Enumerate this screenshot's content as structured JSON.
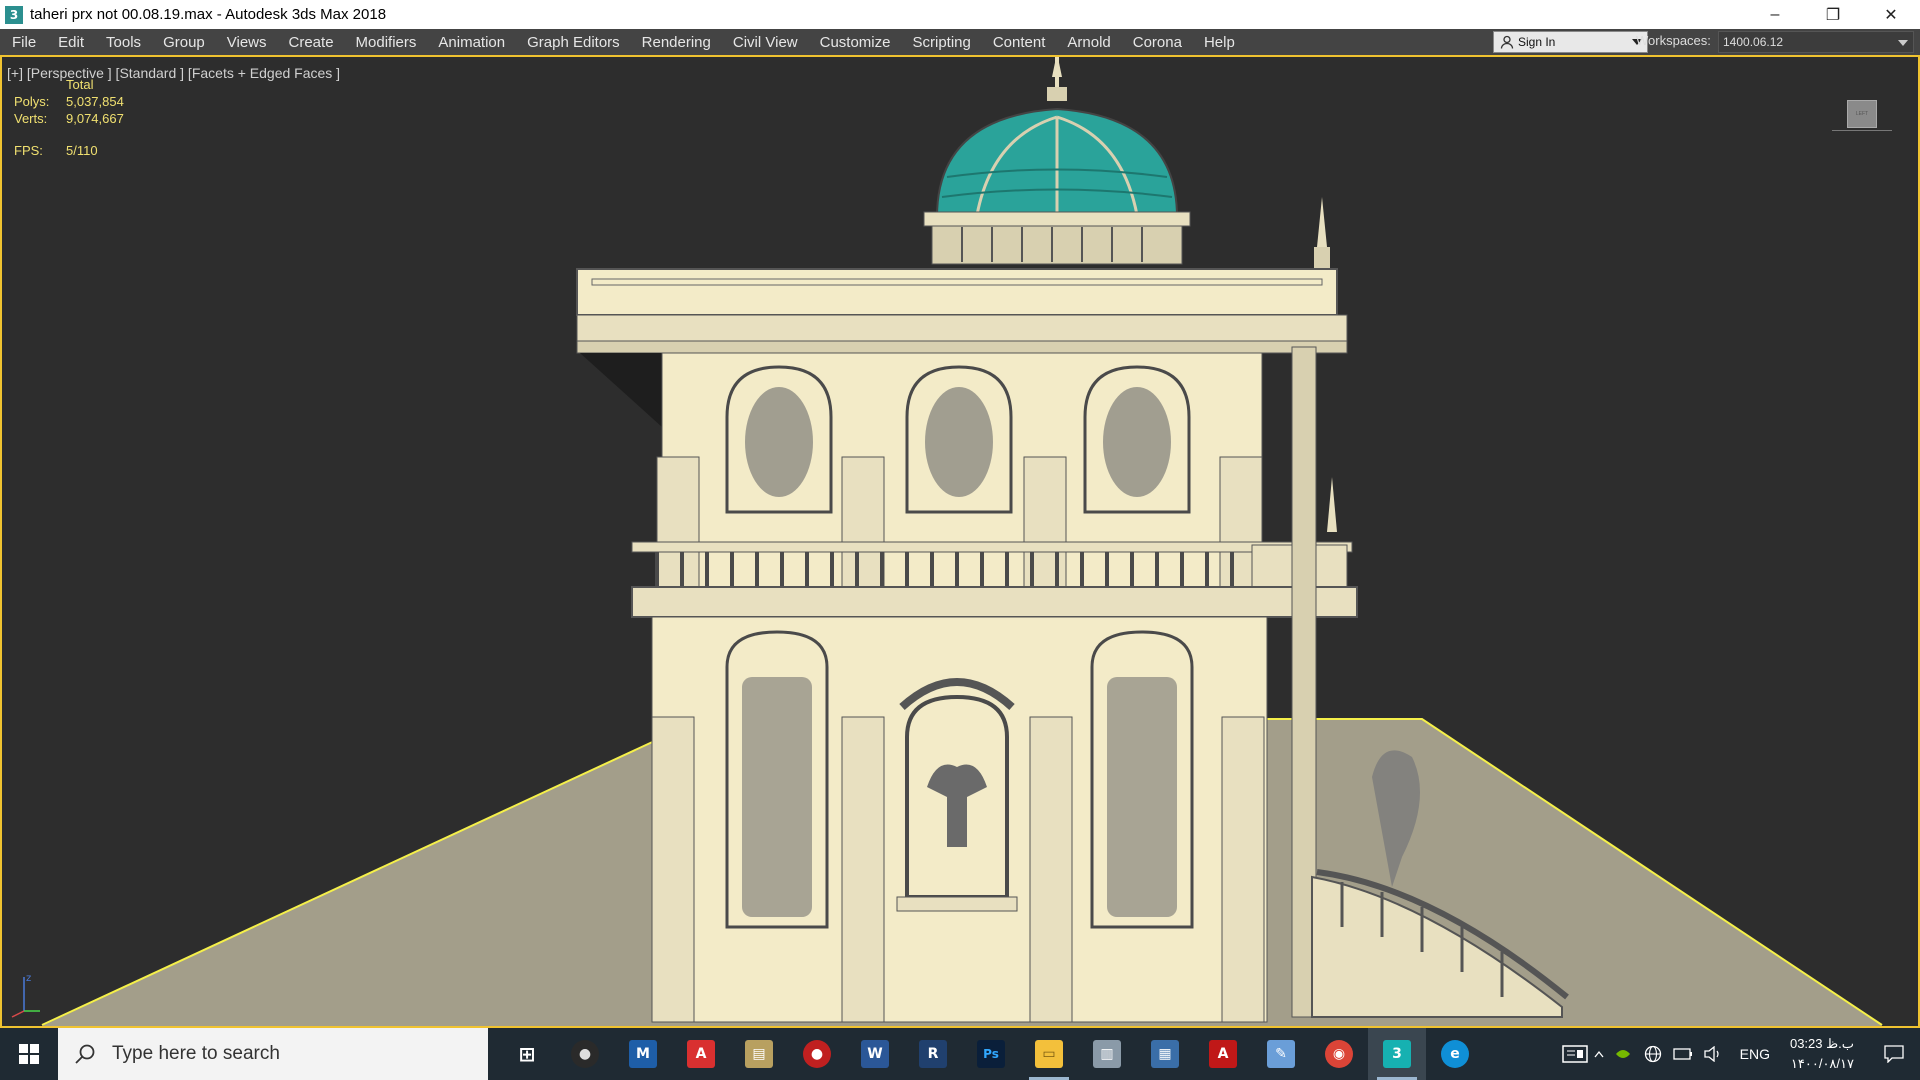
{
  "window": {
    "title": "taheri prx not 00.08.19.max - Autodesk 3ds Max 2018",
    "icon_label": "3",
    "minimize": "–",
    "restore": "❐",
    "close": "✕"
  },
  "menu": {
    "items": [
      "File",
      "Edit",
      "Tools",
      "Group",
      "Views",
      "Create",
      "Modifiers",
      "Animation",
      "Graph Editors",
      "Rendering",
      "Civil View",
      "Customize",
      "Scripting",
      "Content",
      "Arnold",
      "Corona",
      "Help"
    ],
    "sign_in": "Sign In",
    "workspaces_label": "Workspaces:",
    "workspace_value": "1400.06.12"
  },
  "viewport": {
    "label": "[+] [Perspective ] [Standard ] [Facets + Edged Faces ]",
    "stats": {
      "total_label": "Total",
      "polys_label": "Polys:",
      "polys_value": "5,037,854",
      "verts_label": "Verts:",
      "verts_value": "9,074,667",
      "fps_label": "FPS:",
      "fps_value": "5/110"
    },
    "viewcube_label": "LEFT",
    "axis_label": "z",
    "accent_color": "#f0c330",
    "stats_color": "#f0e070",
    "model_color": "#f3ebc8"
  },
  "taskbar": {
    "search_placeholder": "Type here to search",
    "apps": [
      {
        "name": "task-view",
        "glyph": "⊞"
      },
      {
        "name": "obs",
        "glyph": "●"
      },
      {
        "name": "maxon",
        "glyph": "M"
      },
      {
        "name": "pdf-reader",
        "glyph": "A"
      },
      {
        "name": "books",
        "glyph": "▤"
      },
      {
        "name": "record",
        "glyph": "●"
      },
      {
        "name": "word",
        "glyph": "W"
      },
      {
        "name": "revit",
        "glyph": "R"
      },
      {
        "name": "photoshop",
        "glyph": "Ps"
      },
      {
        "name": "file-explorer",
        "glyph": "▭"
      },
      {
        "name": "scanner",
        "glyph": "▥"
      },
      {
        "name": "calculator",
        "glyph": "▦"
      },
      {
        "name": "autocad",
        "glyph": "A"
      },
      {
        "name": "paint",
        "glyph": "✎"
      },
      {
        "name": "chrome",
        "glyph": "◉"
      },
      {
        "name": "3ds-max",
        "glyph": "3"
      },
      {
        "name": "edge",
        "glyph": "e"
      }
    ],
    "lang": "ENG",
    "time": "03:23 ب.ظ",
    "date": "۱۴۰۰/۰۸/۱۷"
  }
}
